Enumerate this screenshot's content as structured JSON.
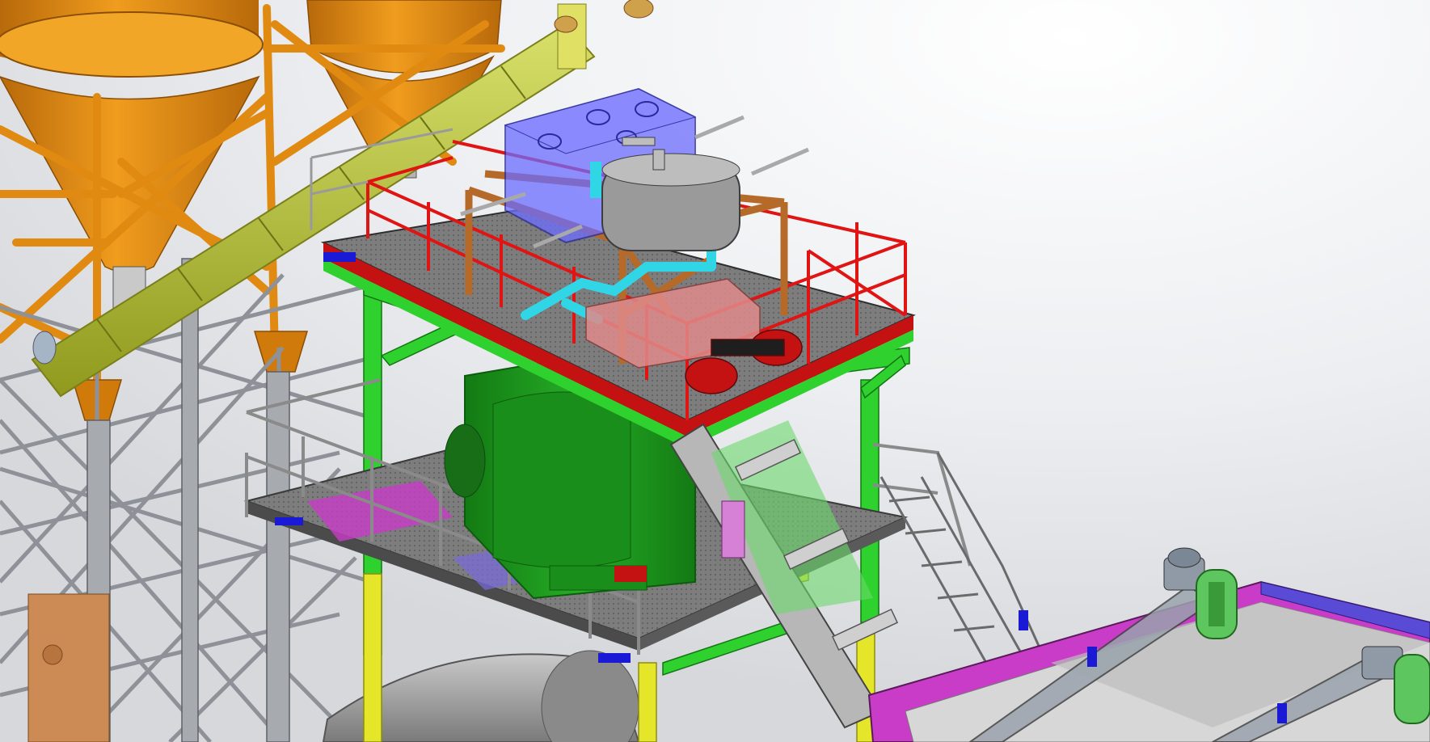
{
  "scene": {
    "subject": "",
    "colors": {
      "background_light": "#ffffff",
      "background_grey": "#d7d9dd",
      "silo_orange": "#e08a12",
      "silo_orange_dark": "#a85f08",
      "scaffold_grey": "#8e9298",
      "platform_green": "#2fd12f",
      "platform_yellow": "#e5e52a",
      "railing_red": "#e11414",
      "deck_grey": "#7a7a7a",
      "mixer_green": "#1f9a1f",
      "hopper_blue": "#6c6cff",
      "tank_grey": "#9a9a9a",
      "pipe_cyan": "#31d6e6",
      "wood_brown": "#b56a2a",
      "conveyor_purple": "#c83cc8",
      "hopper_bin_blue": "#5a4bd6",
      "motor_red": "#c41111",
      "motor_cover_green": "#5ec65e",
      "screw_olive": "#b8c13a",
      "drum_grey": "#9c9c9c"
    }
  }
}
